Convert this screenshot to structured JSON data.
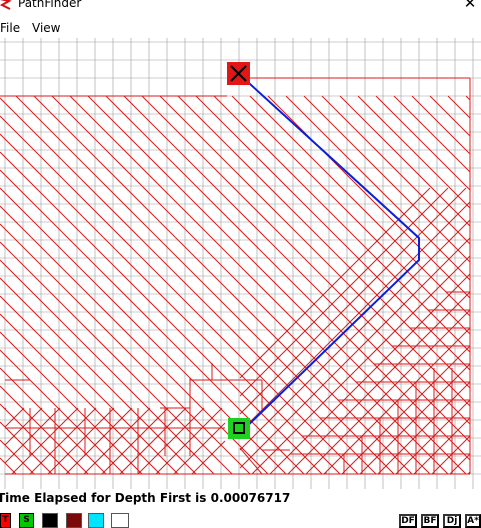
{
  "window": {
    "title": "PathFinder",
    "close_glyph": "✕"
  },
  "menu": [
    {
      "label": "File"
    },
    {
      "label": "View"
    }
  ],
  "grid": {
    "cell_size_units": 18,
    "line_color": "#9a9a9a"
  },
  "colors": {
    "explored": "#d91a1a",
    "path": "#0b1fd8",
    "start": "#20d020",
    "end": "#e31515"
  },
  "status": {
    "text": "Time Elapsed for Depth First is 0.00076717"
  },
  "tools": {
    "start_marker": {
      "label": "T",
      "color": "#ff0000"
    },
    "finish_marker": {
      "label": "S",
      "color": "#00c800"
    },
    "swatches": [
      {
        "name": "wall-black",
        "color": "#000000"
      },
      {
        "name": "wall-darkred",
        "color": "#7a0a0a"
      },
      {
        "name": "cyan",
        "color": "#00e5ff"
      },
      {
        "name": "white",
        "color": "#ffffff"
      }
    ],
    "algorithms": [
      {
        "label": "DF"
      },
      {
        "label": "BF"
      },
      {
        "label": "Dj"
      },
      {
        "label": "A*"
      }
    ]
  }
}
